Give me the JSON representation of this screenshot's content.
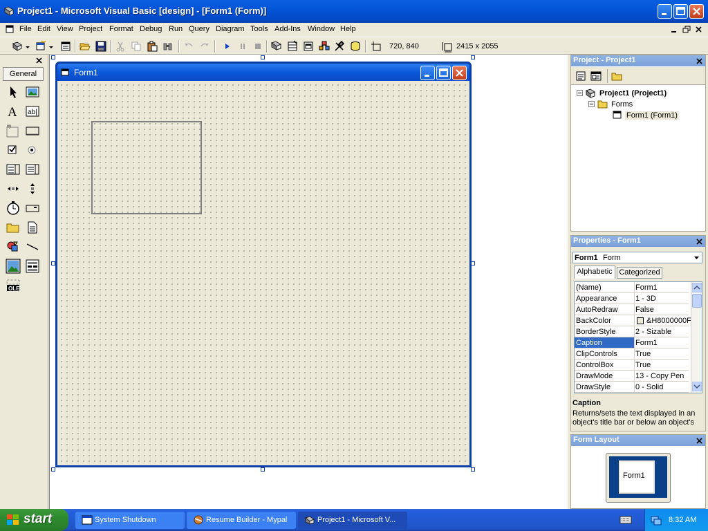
{
  "window": {
    "title": "Project1 - Microsoft Visual Basic [design] - [Form1 (Form)]"
  },
  "menu": {
    "items": [
      {
        "label": "File"
      },
      {
        "label": "Edit"
      },
      {
        "label": "View"
      },
      {
        "label": "Project"
      },
      {
        "label": "Format"
      },
      {
        "label": "Debug"
      },
      {
        "label": "Run"
      },
      {
        "label": "Query"
      },
      {
        "label": "Diagram"
      },
      {
        "label": "Tools"
      },
      {
        "label": "Add-Ins"
      },
      {
        "label": "Window"
      },
      {
        "label": "Help"
      }
    ]
  },
  "toolbar": {
    "position": "720, 840",
    "size": "2415 x 2055"
  },
  "toolbox": {
    "tab_label": "General"
  },
  "form": {
    "caption": "Form1"
  },
  "project_explorer": {
    "title": "Project - Project1",
    "root": "Project1 (Project1)",
    "folder": "Forms",
    "form_item": "Form1 (Form1)"
  },
  "properties": {
    "title": "Properties - Form1",
    "object_name": "Form1",
    "object_type": "Form",
    "tabs": [
      "Alphabetic",
      "Categorized"
    ],
    "rows": [
      {
        "name": "(Name)",
        "value": "Form1"
      },
      {
        "name": "Appearance",
        "value": "1 - 3D"
      },
      {
        "name": "AutoRedraw",
        "value": "False"
      },
      {
        "name": "BackColor",
        "value": "&H8000000F"
      },
      {
        "name": "BorderStyle",
        "value": "2 - Sizable"
      },
      {
        "name": "Caption",
        "value": "Form1"
      },
      {
        "name": "ClipControls",
        "value": "True"
      },
      {
        "name": "ControlBox",
        "value": "True"
      },
      {
        "name": "DrawMode",
        "value": "13 - Copy Pen"
      },
      {
        "name": "DrawStyle",
        "value": "0 - Solid"
      }
    ],
    "selected_row": "Caption",
    "description_title": "Caption",
    "description_text": "Returns/sets the text displayed in an object's title bar or below an object's"
  },
  "form_layout": {
    "title": "Form Layout",
    "preview_label": "Form1"
  },
  "taskbar": {
    "start_label": "start",
    "buttons": [
      {
        "label": "System Shutdown"
      },
      {
        "label": "Resume Builder - Mypal"
      },
      {
        "label": "Project1 - Microsoft V..."
      }
    ],
    "clock": "8:32 AM"
  },
  "colors": {
    "xp_blue": "#0a3fa8",
    "panel_title": "#7ba2d8",
    "selection": "#316ac5",
    "start_green": "#2f8b2f"
  }
}
